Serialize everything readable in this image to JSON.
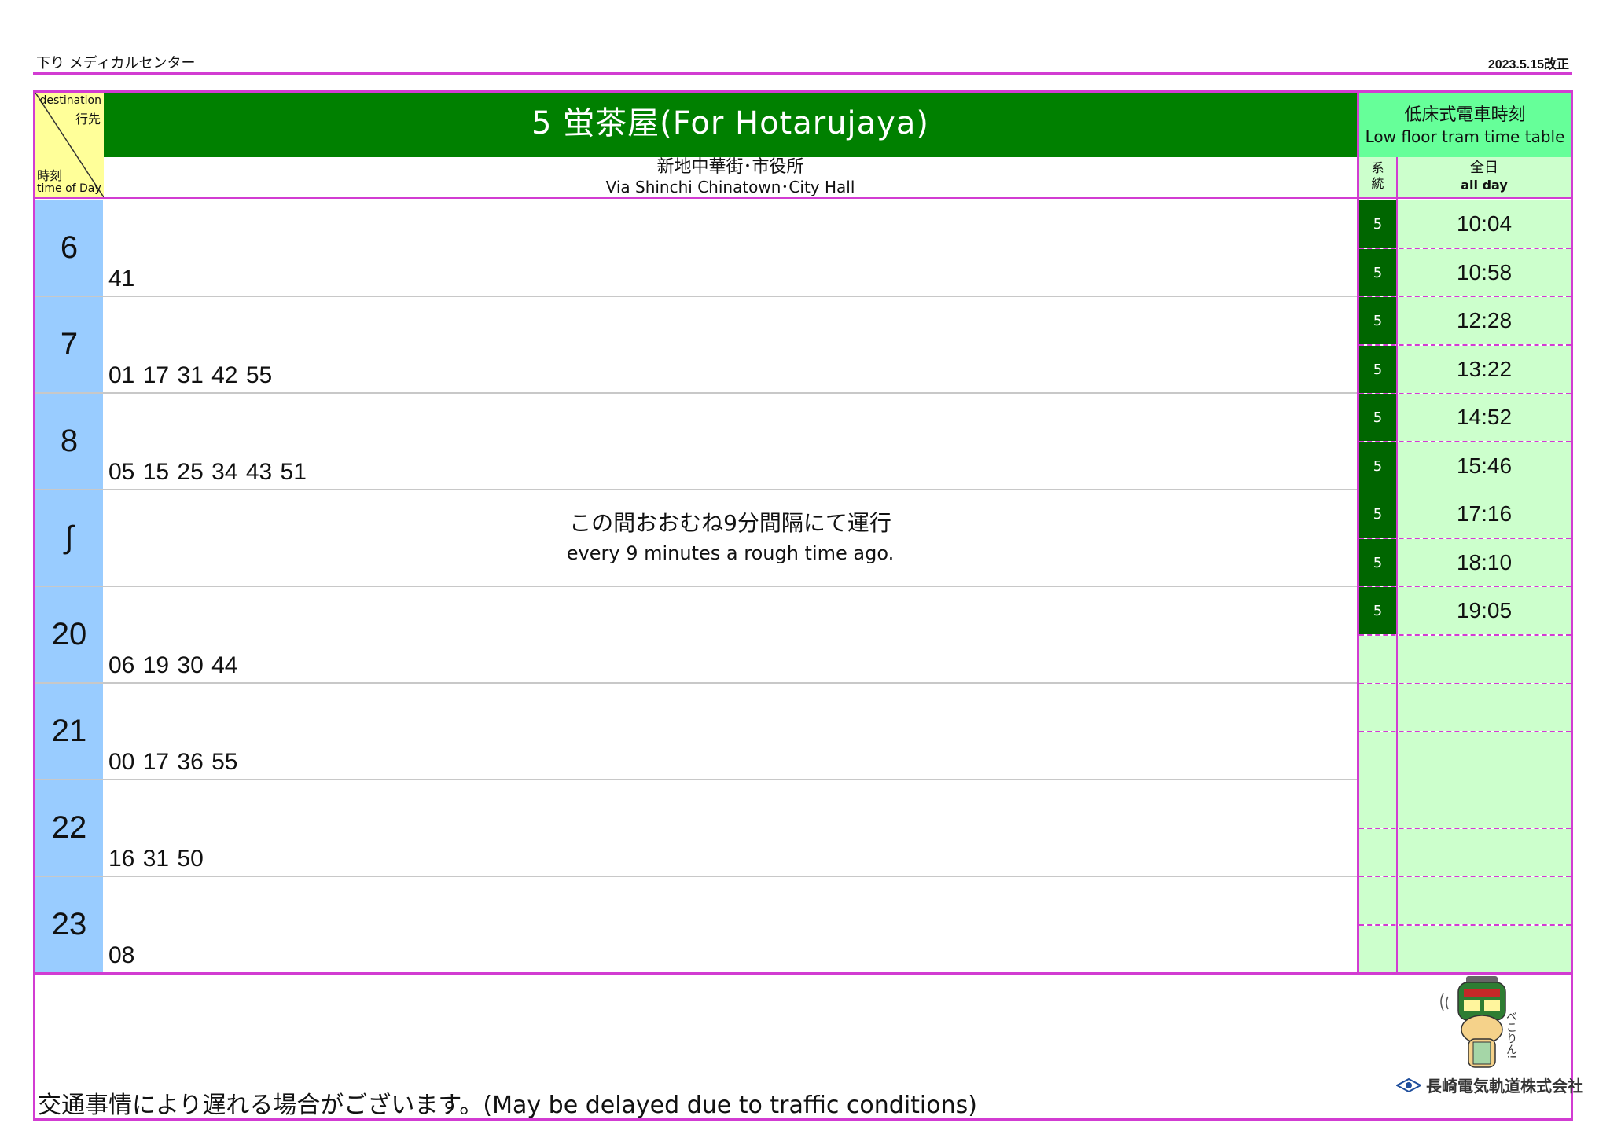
{
  "header": {
    "direction_station": "下り メディカルセンター",
    "revision": "2023.5.15改正"
  },
  "corner": {
    "destination_en": "destination",
    "destination_jp": "行先",
    "time_jp": "時刻",
    "time_en": "time of Day"
  },
  "route": {
    "title": "5 蛍茶屋(For Hotarujaya)",
    "via_jp": "新地中華街･市役所",
    "via_en": "Via Shinchi Chinatown･City Hall"
  },
  "timetable": [
    {
      "hour": "6",
      "minutes": "41"
    },
    {
      "hour": "7",
      "minutes": "01 17 31 42 55"
    },
    {
      "hour": "8",
      "minutes": "05 15 25 34 43 51"
    },
    {
      "hour": "∫",
      "note_jp": "この間おおむね9分間隔にて運行",
      "note_en": "every 9 minutes a rough time ago."
    },
    {
      "hour": "20",
      "minutes": "06 19 30 44"
    },
    {
      "hour": "21",
      "minutes": "00 17 36 55"
    },
    {
      "hour": "22",
      "minutes": "16 31 50"
    },
    {
      "hour": "23",
      "minutes": "08"
    }
  ],
  "low_floor": {
    "title_jp": "低床式電車時刻",
    "title_en": "Low floor tram time table",
    "col_route": "系統",
    "col_allday_jp": "全日",
    "col_allday_en": "all day",
    "rows": [
      {
        "route": "5",
        "time": "10:04"
      },
      {
        "route": "5",
        "time": "10:58"
      },
      {
        "route": "5",
        "time": "12:28"
      },
      {
        "route": "5",
        "time": "13:22"
      },
      {
        "route": "5",
        "time": "14:52"
      },
      {
        "route": "5",
        "time": "15:46"
      },
      {
        "route": "5",
        "time": "17:16"
      },
      {
        "route": "5",
        "time": "18:10"
      },
      {
        "route": "5",
        "time": "19:05"
      },
      {
        "route": "",
        "time": ""
      },
      {
        "route": "",
        "time": ""
      },
      {
        "route": "",
        "time": ""
      },
      {
        "route": "",
        "time": ""
      },
      {
        "route": "",
        "time": ""
      },
      {
        "route": "",
        "time": ""
      },
      {
        "route": "",
        "time": ""
      }
    ]
  },
  "footer": {
    "notice": "交通事情により遅れる場合がございます。(May be delayed due to traffic conditions)",
    "company": "長崎電気軌道株式会社",
    "mascot_text": "べこりん!"
  },
  "colors": {
    "frame": "#d23cd2",
    "title_green": "#008000",
    "low_floor_header": "#66ff99",
    "low_floor_cell": "#ccffcc",
    "hour_blue": "#99ccff",
    "corner_yellow": "#ffff99"
  }
}
